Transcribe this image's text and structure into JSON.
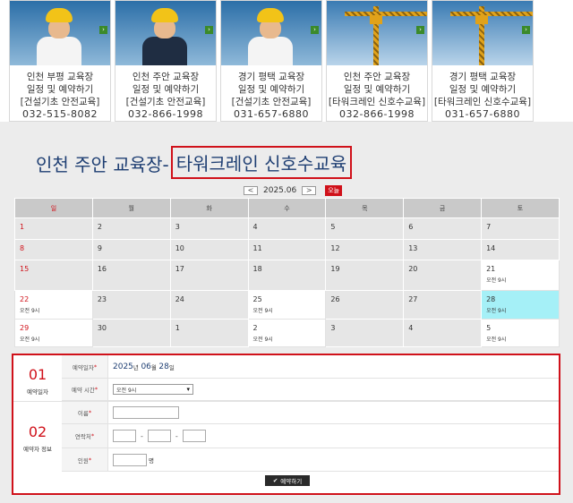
{
  "cards": [
    {
      "lines": [
        "인천 부평 교육장",
        "일정 및 예약하기",
        "[건설기초 안전교육]"
      ],
      "phone": "032-515-8082",
      "image": "worker-ok-gesture"
    },
    {
      "lines": [
        "인천 주안 교육장",
        "일정 및 예약하기",
        "[건설기초 안전교육]"
      ],
      "phone": "032-866-1998",
      "image": "worker-suit"
    },
    {
      "lines": [
        "경기 평택 교육장",
        "일정 및 예약하기",
        "[건설기초 안전교육]"
      ],
      "phone": "031-657-6880",
      "image": "worker-blueprint"
    },
    {
      "lines": [
        "인천 주안 교육장",
        "일정 및 예약하기",
        "[타워크레인 신호수교육]"
      ],
      "phone": "032-866-1998",
      "image": "tower-crane"
    },
    {
      "lines": [
        "경기 평택 교육장",
        "일정 및 예약하기",
        "[타워크레인 신호수교육]"
      ],
      "phone": "031-657-6880",
      "image": "tower-crane"
    }
  ],
  "title": {
    "part1": "인천 주안 교육장-",
    "part2": "타워크레인 신호수교육"
  },
  "month_nav": {
    "prev": "<",
    "month": "2025.06",
    "next": ">",
    "today": "오늘"
  },
  "calendar": {
    "weekdays": [
      "일",
      "월",
      "화",
      "수",
      "목",
      "금",
      "토"
    ],
    "weeks": [
      [
        {
          "d": "1"
        },
        {
          "d": "2"
        },
        {
          "d": "3"
        },
        {
          "d": "4"
        },
        {
          "d": "5"
        },
        {
          "d": "6"
        },
        {
          "d": "7"
        }
      ],
      [
        {
          "d": "8"
        },
        {
          "d": "9"
        },
        {
          "d": "10"
        },
        {
          "d": "11"
        },
        {
          "d": "12"
        },
        {
          "d": "13"
        },
        {
          "d": "14"
        }
      ],
      [
        {
          "d": "15"
        },
        {
          "d": "16"
        },
        {
          "d": "17"
        },
        {
          "d": "18"
        },
        {
          "d": "19"
        },
        {
          "d": "20"
        },
        {
          "d": "21",
          "slot": "오전 9시"
        }
      ],
      [
        {
          "d": "22",
          "slot": "오전 9시"
        },
        {
          "d": "23"
        },
        {
          "d": "24"
        },
        {
          "d": "25",
          "slot": "오전 9시"
        },
        {
          "d": "26"
        },
        {
          "d": "27"
        },
        {
          "d": "28",
          "slot": "오전 9시",
          "selected": true
        }
      ],
      [
        {
          "d": "29",
          "slot": "오전 9시"
        },
        {
          "d": "30"
        },
        {
          "d": "1"
        },
        {
          "d": "2",
          "slot": "오전 9시"
        },
        {
          "d": "3"
        },
        {
          "d": "4"
        },
        {
          "d": "5",
          "slot": "오전 9시"
        }
      ]
    ]
  },
  "form": {
    "step1": {
      "num": "01",
      "label": "예약일자"
    },
    "step2": {
      "num": "02",
      "label": "예약자 정보"
    },
    "date_label": "예약일자",
    "date_value": {
      "year": "2025",
      "year_unit": "년",
      "month": "06",
      "month_unit": "월",
      "day": "28",
      "day_unit": "일"
    },
    "time_label": "예약 시간",
    "time_value": "오전 9시",
    "name_label": "이름",
    "phone_label": "연락처",
    "phone_sep": "-",
    "people_label": "인원",
    "people_unit": "명",
    "required_mark": "*",
    "submit_label": "예약하기"
  },
  "colors": {
    "accent_red": "#d0111a",
    "title_blue": "#1f3f73",
    "selected_cell": "#a5f0f7"
  }
}
